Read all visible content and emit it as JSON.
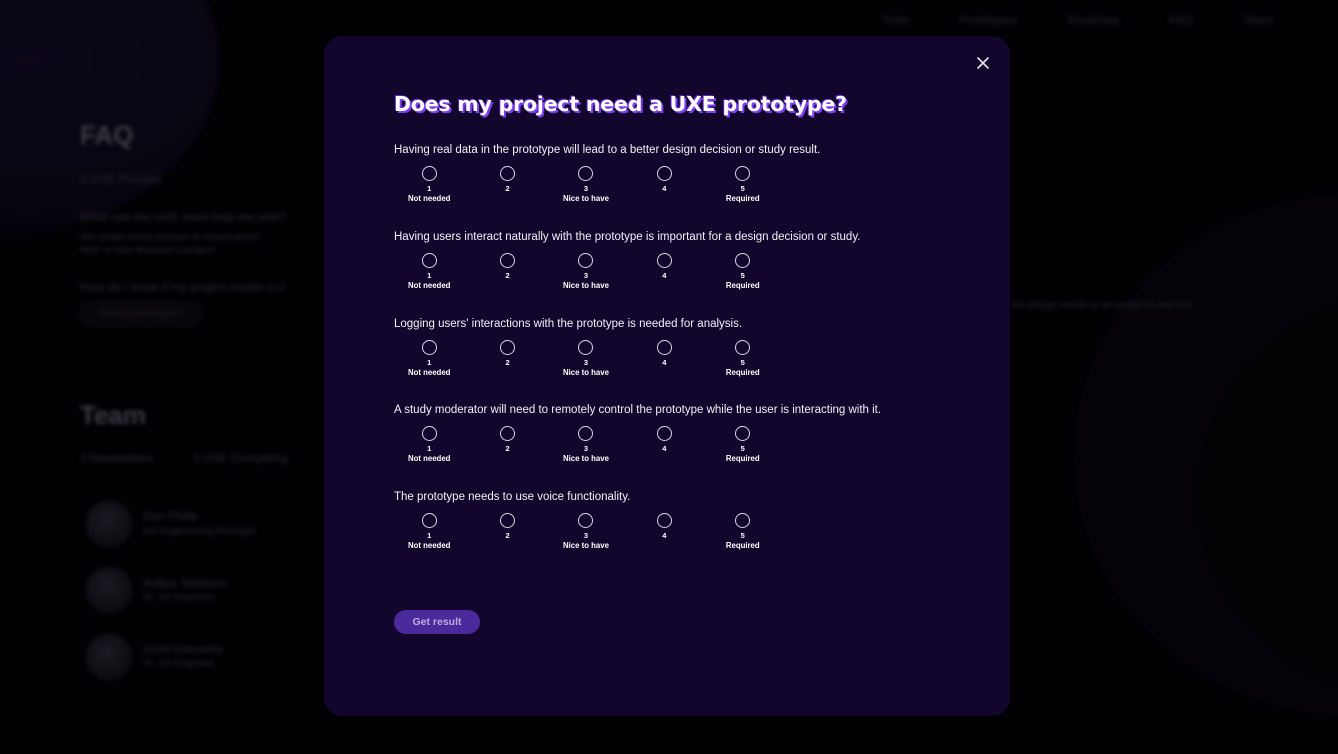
{
  "background": {
    "nav": [
      "Tools",
      "Prototypes",
      "Roadmap",
      "FAQ",
      "Team"
    ],
    "faq_heading": "FAQ",
    "faq_meta": "3 UXE Process",
    "faq_question_1": "What can the UXE team help me with?",
    "faq_answer_line_1": "We create some product or robust protot",
    "faq_answer_line_2": "NDF or Dev Request a project",
    "faq_question_2": "How do I know if my project needs a U",
    "faq_button": "Need a prototype?",
    "right_text": "No design needs to be tested or real use",
    "team_heading": "Team",
    "team_filters": [
      "3 Newsletters",
      "3 UXE Everything"
    ],
    "members": [
      {
        "name": "Dan Philip",
        "role": "UX Engineering Manager"
      },
      {
        "name": "Aditya Tetikkam",
        "role": "Sr. UX Engineer"
      },
      {
        "name": "Scott Hanowitz",
        "role": "Sr. UX Engineer"
      }
    ]
  },
  "modal": {
    "title": "Does my project need a UXE prototype?",
    "close_icon": "close-icon",
    "scale": [
      {
        "num": "1",
        "label": "Not needed"
      },
      {
        "num": "2",
        "label": ""
      },
      {
        "num": "3",
        "label": "Nice to have"
      },
      {
        "num": "4",
        "label": ""
      },
      {
        "num": "5",
        "label": "Required"
      }
    ],
    "questions": [
      "Having real data in the prototype will lead to a better design decision or study result.",
      "Having users interact naturally with the prototype is important for a design decision or study.",
      "Logging users' interactions with the prototype is needed for analysis.",
      "A study moderator will need to remotely control the prototype while the user is interacting with it.",
      "The prototype needs to use voice functionality."
    ],
    "submit_label": "Get result"
  },
  "colors": {
    "modal_bg": "#12062c",
    "accent": "#7b3ff2",
    "button_bg": "#4a2a9c"
  }
}
